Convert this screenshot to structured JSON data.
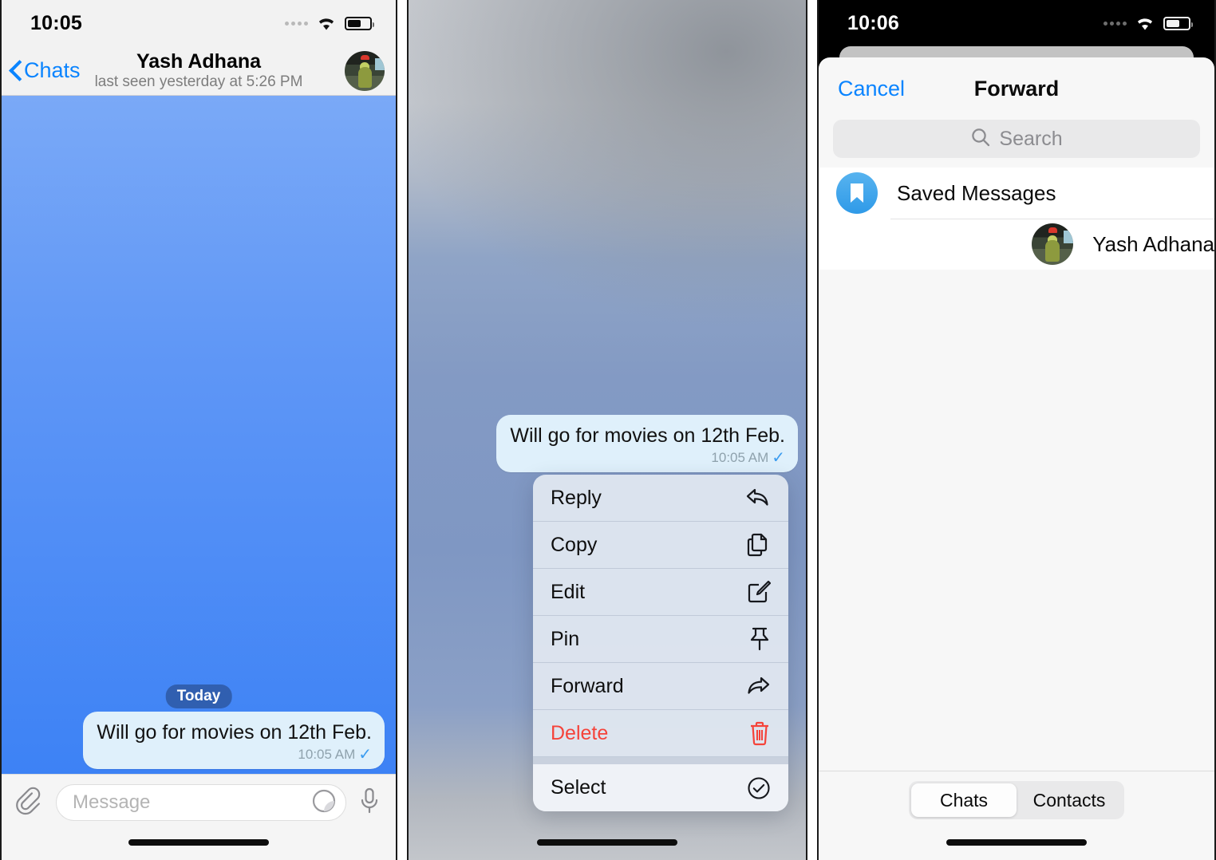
{
  "panels": {
    "chat": {
      "status": {
        "time": "10:05"
      },
      "header": {
        "back_label": "Chats",
        "title": "Yash Adhana",
        "subtitle": "last seen yesterday at 5:26 PM",
        "avatar_name": "yash-adhana-avatar"
      },
      "day_separator": "Today",
      "message": {
        "text": "Will go for movies on 12th Feb.",
        "time": "10:05 AM",
        "tick": "✓"
      },
      "composer": {
        "attach_icon": "paperclip-icon",
        "placeholder": "Message",
        "sticker_icon": "sticker-icon",
        "mic_icon": "microphone-icon"
      }
    },
    "context_menu": {
      "message": {
        "text": "Will go for movies on 12th Feb.",
        "time": "10:05 AM",
        "tick": "✓"
      },
      "items": [
        {
          "label": "Reply",
          "icon": "reply-icon",
          "danger": false
        },
        {
          "label": "Copy",
          "icon": "copy-icon",
          "danger": false
        },
        {
          "label": "Edit",
          "icon": "edit-icon",
          "danger": false
        },
        {
          "label": "Pin",
          "icon": "pin-icon",
          "danger": false
        },
        {
          "label": "Forward",
          "icon": "forward-icon",
          "danger": false
        },
        {
          "label": "Delete",
          "icon": "trash-icon",
          "danger": true
        },
        {
          "label": "Select",
          "icon": "check-circle-icon",
          "danger": false
        }
      ]
    },
    "forward": {
      "status": {
        "time": "10:06"
      },
      "header": {
        "cancel_label": "Cancel",
        "title": "Forward"
      },
      "search": {
        "placeholder": "Search",
        "icon": "search-icon"
      },
      "recipients": [
        {
          "label": "Saved Messages",
          "avatar": "bookmark-icon"
        },
        {
          "label": "Yash Adhana",
          "avatar": "yash-adhana-avatar"
        }
      ],
      "segments": [
        {
          "label": "Chats",
          "active": true
        },
        {
          "label": "Contacts",
          "active": false
        }
      ]
    }
  },
  "colors": {
    "accent_blue": "#0a84ff",
    "bubble_bg": "#dff0fb",
    "danger_red": "#f5433a",
    "chat_bg_top": "#7aa9f7",
    "chat_bg_bottom": "#3d82f5",
    "saved_blue": "#2f9ae8"
  }
}
